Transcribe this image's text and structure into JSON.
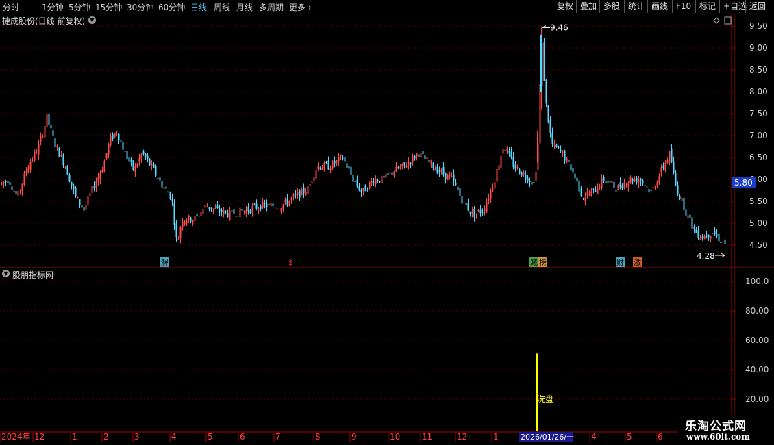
{
  "toolbar": {
    "periods": [
      {
        "label": "分时",
        "active": false
      },
      {
        "label": "1分钟",
        "active": false
      },
      {
        "label": "5分钟",
        "active": false
      },
      {
        "label": "15分钟",
        "active": false
      },
      {
        "label": "30分钟",
        "active": false
      },
      {
        "label": "60分钟",
        "active": false
      },
      {
        "label": "日线",
        "active": true
      },
      {
        "label": "周线",
        "active": false
      },
      {
        "label": "月线",
        "active": false
      },
      {
        "label": "多周期",
        "active": false
      },
      {
        "label": "更多",
        "active": false
      }
    ],
    "right_buttons": [
      "复权",
      "叠加",
      "多股",
      "统计",
      "画线",
      "F10",
      "标记",
      "+自选",
      "返回"
    ]
  },
  "main_chart": {
    "title": "捷成股份(日线 前复权)",
    "price_axis": [
      "9.50",
      "9.00",
      "8.50",
      "8.00",
      "7.50",
      "7.00",
      "6.50",
      "6.00",
      "5.50",
      "5.00",
      "4.50"
    ],
    "current_price": "5.80",
    "high_label": "9.46",
    "low_label": "4.28",
    "event_markers": [
      {
        "text": "解",
        "color": "#5bc0de"
      },
      {
        "text": "$",
        "color": "#e03030"
      },
      {
        "text": "减",
        "color": "#5cb85c"
      },
      {
        "text": "榜",
        "color": "#f0ad4e"
      },
      {
        "text": "财",
        "color": "#5bc0de"
      },
      {
        "text": "激",
        "color": "#f07030"
      }
    ]
  },
  "indicator_panel": {
    "title": "股朋指标网",
    "axis": [
      "100.0",
      "80.00",
      "60.00",
      "40.00",
      "20.00"
    ],
    "annotation": "洗盘",
    "bar_value": 51
  },
  "date_axis": {
    "labels": [
      "2024年",
      "12",
      "1",
      "2",
      "3",
      "4",
      "5",
      "6",
      "7",
      "8",
      "9",
      "10",
      "11",
      "12",
      "1",
      "2026/01/26/一",
      "4",
      "5",
      "6"
    ]
  },
  "watermark": {
    "title": "乐淘公式网",
    "url": "www.60lt.com"
  },
  "colors": {
    "up": "#ff4a4a",
    "down": "#54d8ff",
    "grid": "#5a0000",
    "frame": "#b00000",
    "indicator_bar": "#ffff00"
  }
}
